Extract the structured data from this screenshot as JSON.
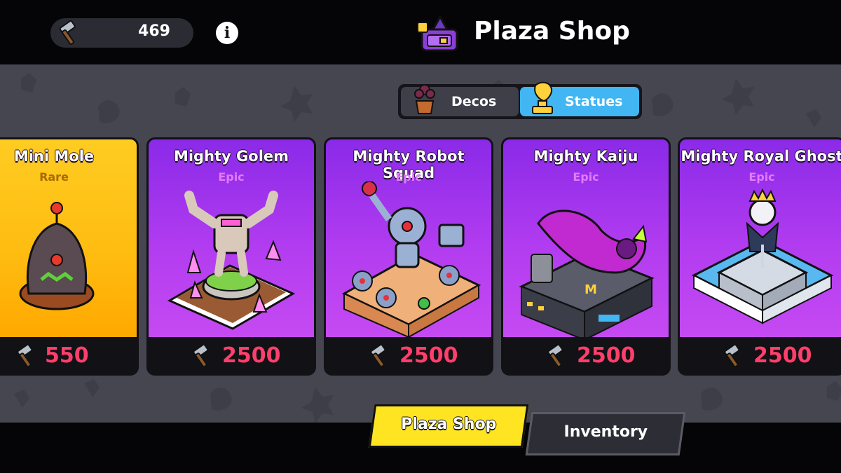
{
  "header": {
    "currency_amount": "469",
    "currency_icon": "hammer-icon",
    "info_label": "i",
    "title": "Plaza Shop",
    "title_icon": "plaza-shop-icon"
  },
  "toggle": {
    "decos_label": "Decos",
    "statues_label": "Statues",
    "active": "Statues"
  },
  "cards": [
    {
      "name": "Mini Mole",
      "rarity": "Rare",
      "price": "550",
      "theme": "rare"
    },
    {
      "name": "Mighty Golem",
      "rarity": "Epic",
      "price": "2500",
      "theme": "epic"
    },
    {
      "name": "Mighty Robot Squad",
      "rarity": "Epic",
      "price": "2500",
      "theme": "epic"
    },
    {
      "name": "Mighty Kaiju",
      "rarity": "Epic",
      "price": "2500",
      "theme": "epic"
    },
    {
      "name": "Mighty Royal Ghost",
      "rarity": "Epic",
      "price": "2500",
      "theme": "epic"
    }
  ],
  "bottom_tabs": {
    "plaza_shop_label": "Plaza Shop",
    "inventory_label": "Inventory",
    "active": "Plaza Shop"
  },
  "colors": {
    "epic": "#b23cf0",
    "rare": "#ffbb10",
    "price": "#ff3f6b",
    "active_toggle": "#41b6f2",
    "active_tab": "#ffe521"
  }
}
